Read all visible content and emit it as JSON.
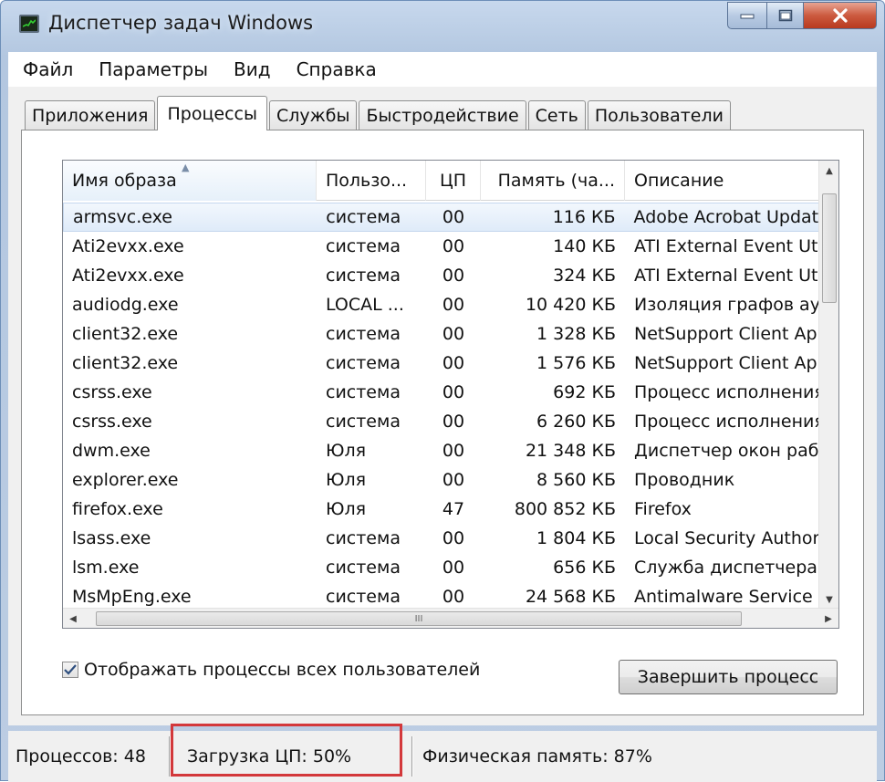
{
  "window": {
    "title": "Диспетчер задач Windows",
    "icon": "task-manager-icon"
  },
  "menu": [
    "Файл",
    "Параметры",
    "Вид",
    "Справка"
  ],
  "tabs": [
    {
      "label": "Приложения",
      "active": false
    },
    {
      "label": "Процессы",
      "active": true
    },
    {
      "label": "Службы",
      "active": false
    },
    {
      "label": "Быстродействие",
      "active": false
    },
    {
      "label": "Сеть",
      "active": false
    },
    {
      "label": "Пользователи",
      "active": false
    }
  ],
  "table": {
    "columns": {
      "name": "Имя образа",
      "user": "Пользо...",
      "cpu": "ЦП",
      "memory": "Память (ча...",
      "description": "Описание"
    },
    "rows": [
      {
        "name": "armsvc.exe",
        "user": "система",
        "cpu": "00",
        "memory": "116 КБ",
        "description": "Adobe Acrobat Updat",
        "selected": true
      },
      {
        "name": "Ati2evxx.exe",
        "user": "система",
        "cpu": "00",
        "memory": "140 КБ",
        "description": "ATI External Event Ut"
      },
      {
        "name": "Ati2evxx.exe",
        "user": "система",
        "cpu": "00",
        "memory": "324 КБ",
        "description": "ATI External Event Ut"
      },
      {
        "name": "audiodg.exe",
        "user": "LOCAL ...",
        "cpu": "00",
        "memory": "10 420 КБ",
        "description": "Изоляция графов ау"
      },
      {
        "name": "client32.exe",
        "user": "система",
        "cpu": "00",
        "memory": "1 328 КБ",
        "description": "NetSupport Client App"
      },
      {
        "name": "client32.exe",
        "user": "система",
        "cpu": "00",
        "memory": "1 576 КБ",
        "description": "NetSupport Client App"
      },
      {
        "name": "csrss.exe",
        "user": "система",
        "cpu": "00",
        "memory": "692 КБ",
        "description": "Процесс исполнения"
      },
      {
        "name": "csrss.exe",
        "user": "система",
        "cpu": "00",
        "memory": "6 260 КБ",
        "description": "Процесс исполнения"
      },
      {
        "name": "dwm.exe",
        "user": "Юля",
        "cpu": "00",
        "memory": "21 348 КБ",
        "description": "Диспетчер окон раб"
      },
      {
        "name": "explorer.exe",
        "user": "Юля",
        "cpu": "00",
        "memory": "8 560 КБ",
        "description": "Проводник"
      },
      {
        "name": "firefox.exe",
        "user": "Юля",
        "cpu": "47",
        "memory": "800 852 КБ",
        "description": "Firefox"
      },
      {
        "name": "lsass.exe",
        "user": "система",
        "cpu": "00",
        "memory": "1 804 КБ",
        "description": "Local Security Authori"
      },
      {
        "name": "lsm.exe",
        "user": "система",
        "cpu": "00",
        "memory": "656 КБ",
        "description": "Служба диспетчера"
      },
      {
        "name": "MsMpEng.exe",
        "user": "система",
        "cpu": "00",
        "memory": "24 568 КБ",
        "description": "Antimalware Service E"
      }
    ],
    "hscroll_grip": "III"
  },
  "show_all_users": {
    "label": "Отображать процессы всех пользователей",
    "checked": true
  },
  "end_process_label": "Завершить процесс",
  "status": {
    "processes": "Процессов: 48",
    "cpu_load": "Загрузка ЦП: 50%",
    "physical_memory": "Физическая память: 87%"
  },
  "colors": {
    "highlight_border": "#d3383b",
    "selection": "#dfebf9",
    "close_button": "#cc5a3f"
  }
}
